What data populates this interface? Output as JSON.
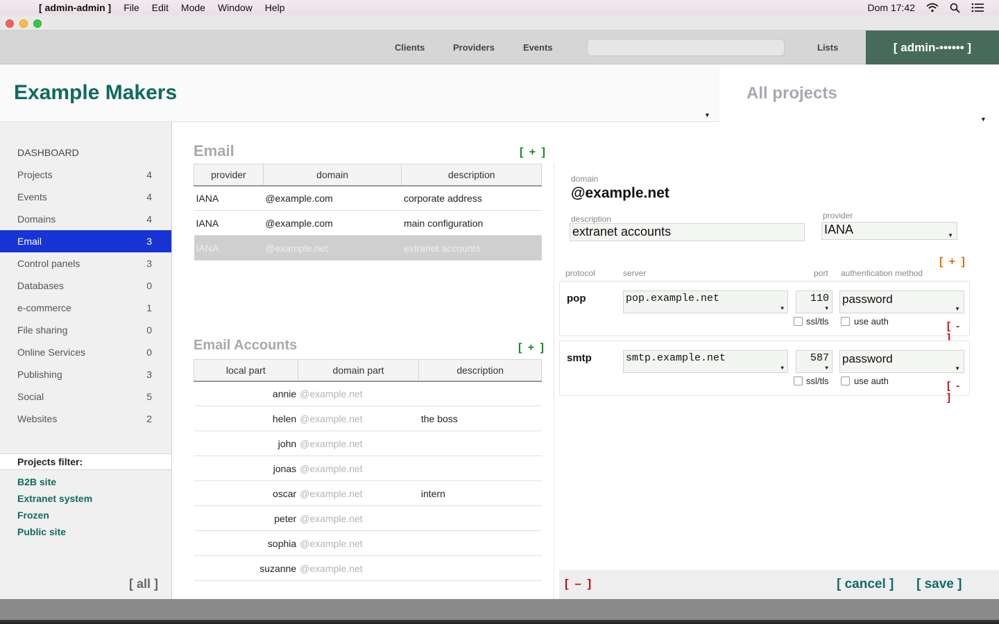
{
  "menubar": {
    "apple": "",
    "app_name": "[ admin-admin ]",
    "menus": [
      "File",
      "Edit",
      "Mode",
      "Window",
      "Help"
    ],
    "clock": "Dom 17:42"
  },
  "topnav": {
    "items": [
      "Clients",
      "Providers",
      "Events",
      "Lists"
    ],
    "search_placeholder": "",
    "admin_label": "[ admin-•••••• ]"
  },
  "header": {
    "company": "Example Makers",
    "project_scope": "All projects"
  },
  "sidebar": {
    "dashboard": "DASHBOARD",
    "items": [
      {
        "label": "Projects",
        "count": "4"
      },
      {
        "label": "Events",
        "count": "4"
      },
      {
        "label": "Domains",
        "count": "4"
      },
      {
        "label": "Email",
        "count": "3"
      },
      {
        "label": "Control panels",
        "count": "3"
      },
      {
        "label": "Databases",
        "count": "0"
      },
      {
        "label": "e-commerce",
        "count": "1"
      },
      {
        "label": "File sharing",
        "count": "0"
      },
      {
        "label": "Online Services",
        "count": "0"
      },
      {
        "label": "Publishing",
        "count": "3"
      },
      {
        "label": "Social",
        "count": "5"
      },
      {
        "label": "Websites",
        "count": "2"
      }
    ],
    "active_item": "Email",
    "filter_title": "Projects filter:",
    "filters": [
      "B2B site",
      "Extranet system",
      "Frozen",
      "Public site"
    ],
    "all_label": "[ all ]"
  },
  "email": {
    "title": "Email",
    "add_label": "[ + ]",
    "columns": [
      "provider",
      "domain",
      "description"
    ],
    "rows": [
      {
        "provider": "IANA",
        "domain": "@example.com",
        "description": "corporate address"
      },
      {
        "provider": "IANA",
        "domain": "@example.com",
        "description": "main configuration"
      },
      {
        "provider": "IANA",
        "domain": "@example.net",
        "description": "extranet accounts"
      }
    ]
  },
  "accounts": {
    "title": "Email Accounts",
    "add_label": "[ + ]",
    "columns": [
      "local part",
      "domain part",
      "description"
    ],
    "rows": [
      {
        "local": "annie",
        "domain": "@example.net",
        "description": ""
      },
      {
        "local": "helen",
        "domain": "@example.net",
        "description": "the boss"
      },
      {
        "local": "john",
        "domain": "@example.net",
        "description": ""
      },
      {
        "local": "jonas",
        "domain": "@example.net",
        "description": ""
      },
      {
        "local": "oscar",
        "domain": "@example.net",
        "description": "intern"
      },
      {
        "local": "peter",
        "domain": "@example.net",
        "description": ""
      },
      {
        "local": "sophia",
        "domain": "@example.net",
        "description": ""
      },
      {
        "local": "suzanne",
        "domain": "@example.net",
        "description": ""
      }
    ]
  },
  "detail": {
    "domain_label": "domain",
    "domain_value": "@example.net",
    "description_label": "description",
    "description_value": "extranet accounts",
    "provider_label": "provider",
    "provider_value": "IANA",
    "add_server_label": "[ + ]",
    "col_protocol": "protocol",
    "col_server": "server",
    "col_port": "port",
    "col_auth": "authentication method",
    "servers": [
      {
        "protocol": "pop",
        "server": "pop.example.net",
        "port": "110",
        "auth": "password",
        "ssl_label": "ssl/tls",
        "useauth_label": "use auth",
        "remove_label": "[ - ]"
      },
      {
        "protocol": "smtp",
        "server": "smtp.example.net",
        "port": "587",
        "auth": "password",
        "ssl_label": "ssl/tls",
        "useauth_label": "use auth",
        "remove_label": "[ - ]"
      }
    ],
    "delete_label": "[ – ]",
    "cancel_label": "[ cancel ]",
    "save_label": "[ save ]"
  }
}
